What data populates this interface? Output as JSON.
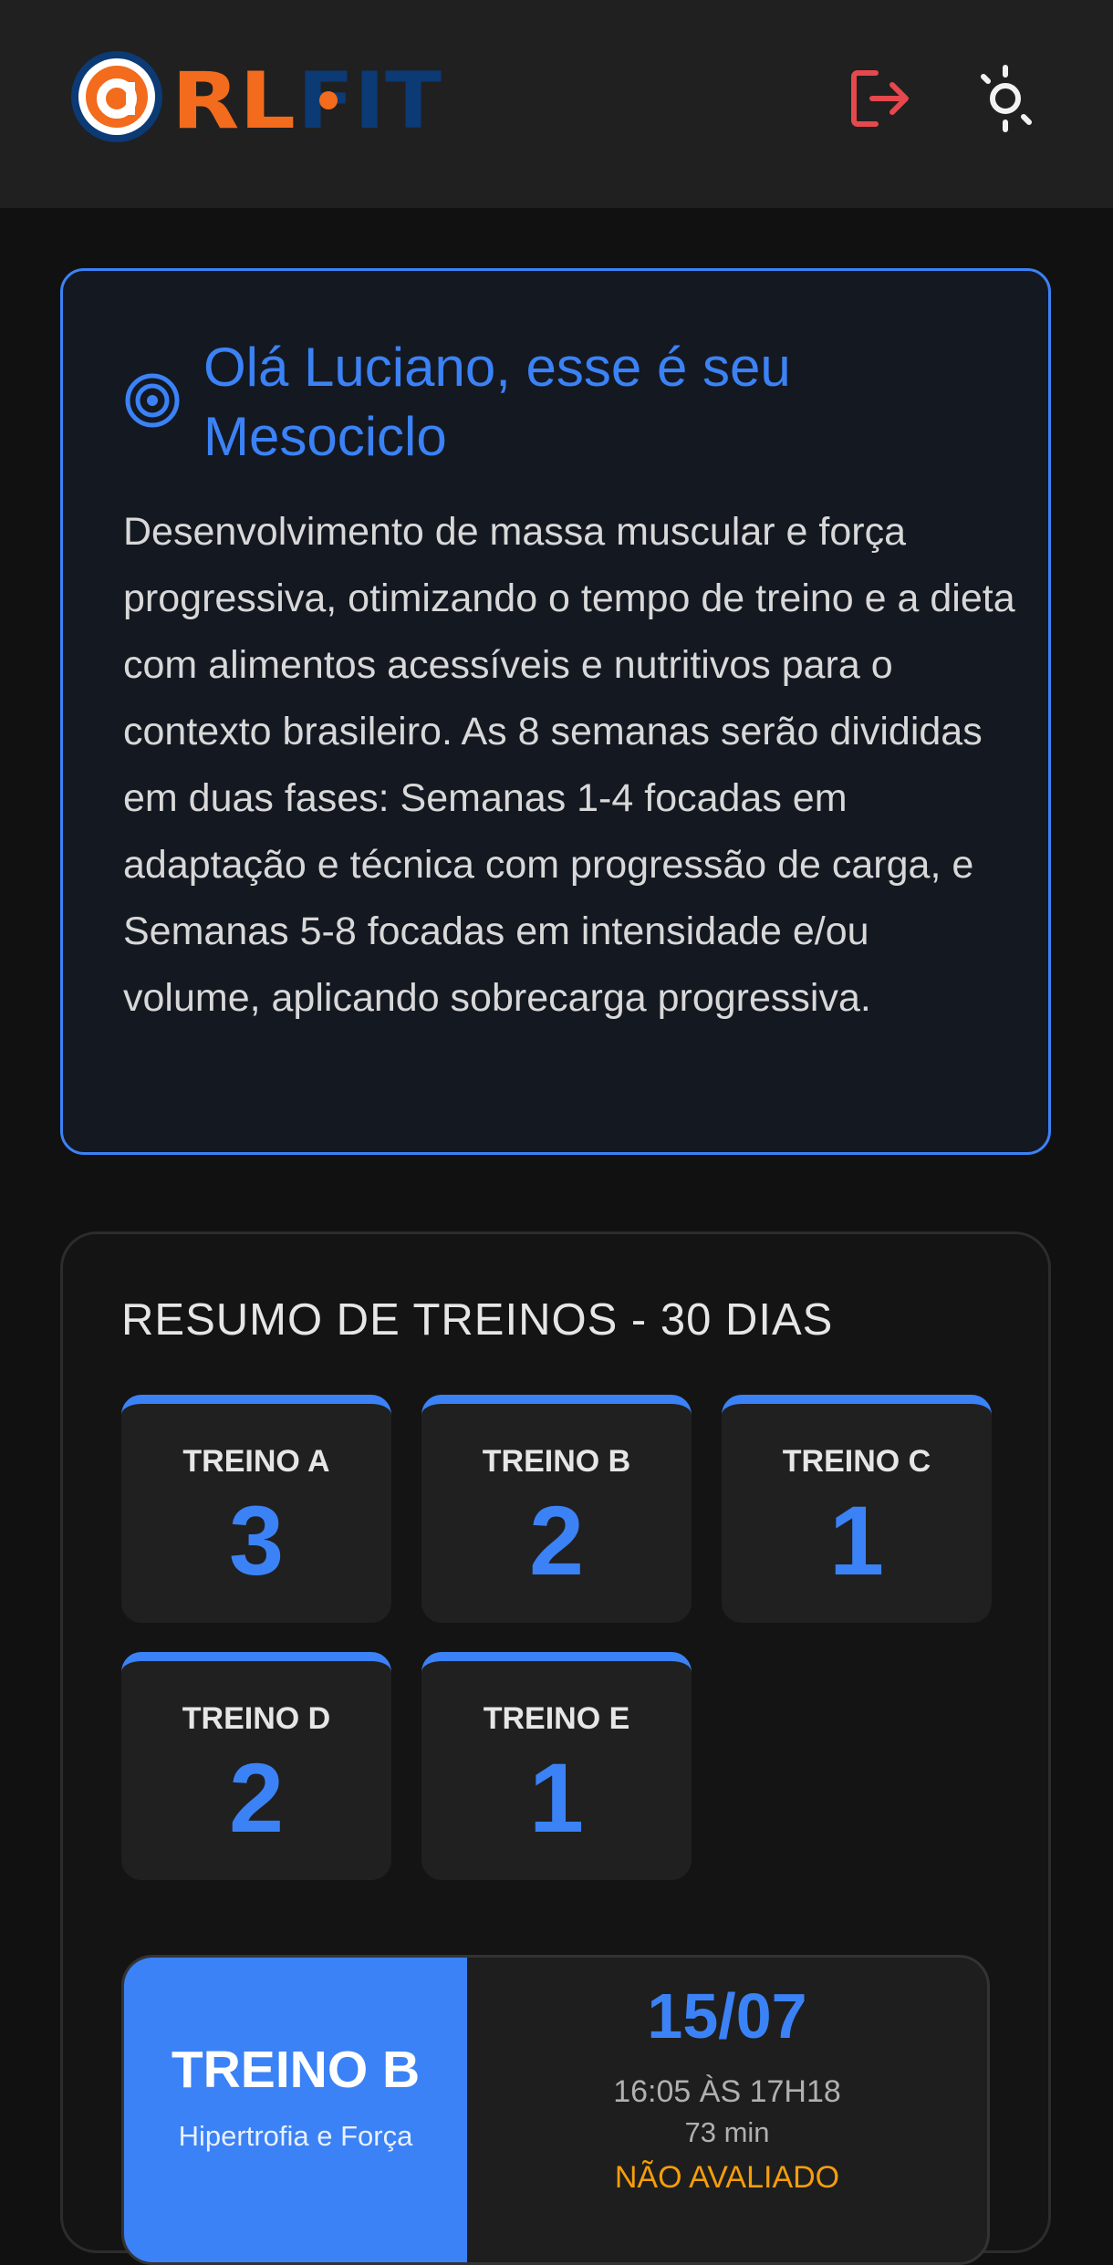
{
  "header": {
    "logo_text": "RLFIT",
    "logout_icon": "logout-icon",
    "theme_icon": "sun-icon"
  },
  "mesocycle": {
    "title": "Olá Luciano, esse é seu Mesociclo",
    "description": "Desenvolvimento de massa muscular e força progressiva, otimizando o tempo de treino e a dieta com alimentos acessíveis e nutritivos para o contexto brasileiro. As 8 semanas serão divididas em duas fases: Semanas 1-4 focadas em adaptação e técnica com progressão de carga, e Semanas 5-8 focadas em intensidade e/ou volume, aplicando sobrecarga progressiva.",
    "icon": "target-icon"
  },
  "summary": {
    "title": "RESUMO DE TREINOS - 30 DIAS",
    "stats": [
      {
        "label": "TREINO A",
        "value": "3"
      },
      {
        "label": "TREINO B",
        "value": "2"
      },
      {
        "label": "TREINO C",
        "value": "1"
      },
      {
        "label": "TREINO D",
        "value": "2"
      },
      {
        "label": "TREINO E",
        "value": "1"
      }
    ]
  },
  "session": {
    "name": "TREINO B",
    "subtitle": "Hipertrofia e Força",
    "date": "15/07",
    "time": "16:05 ÀS 17H18",
    "duration": "73 min",
    "status": "NÃO AVALIADO"
  },
  "colors": {
    "accent": "#3b82f6",
    "brand_orange": "#f36b1c",
    "brand_navy": "#0b3a75",
    "status_warning": "#f59e0b",
    "logout_red": "#e5484d"
  }
}
